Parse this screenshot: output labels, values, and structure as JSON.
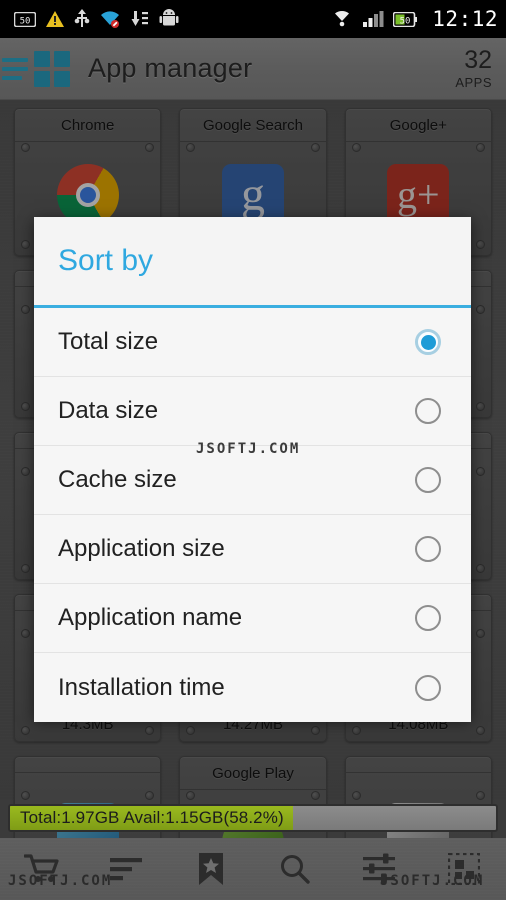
{
  "statusbar": {
    "left_icons": [
      "battery-50-icon",
      "warning-triangle-icon",
      "usb-debug-icon",
      "wifi-off-icon",
      "download-icon",
      "android-robot-icon"
    ],
    "right_icons": [
      "wifi-icon",
      "signal-bars-icon",
      "battery-icon"
    ],
    "time": "12:12"
  },
  "actionbar": {
    "menu_icon": "hamburger-icon",
    "app_icon": "grid-icon",
    "title": "App manager",
    "count": "32",
    "count_label": "APPS",
    "accent": "#1b687e"
  },
  "grid": {
    "tiles": [
      {
        "name": "Chrome",
        "size": "",
        "icon": "chrome"
      },
      {
        "name": "Google Search",
        "size": "",
        "icon": "gsearch"
      },
      {
        "name": "Google+",
        "size": "",
        "icon": "gplus"
      },
      {
        "name": "",
        "size": "",
        "icon": "gen4"
      },
      {
        "name": "",
        "size": "",
        "icon": "gen5"
      },
      {
        "name": "",
        "size": "",
        "icon": "gen6"
      },
      {
        "name": "",
        "size": "",
        "icon": "gen3"
      },
      {
        "name": "",
        "size": "",
        "icon": "gen1"
      },
      {
        "name": "",
        "size": "",
        "icon": "gen2"
      },
      {
        "name": "",
        "size": "14.3MB",
        "icon": "gen1"
      },
      {
        "name": "",
        "size": "14.27MB",
        "icon": "gen2"
      },
      {
        "name": "",
        "size": "14.08MB",
        "icon": "gen3"
      },
      {
        "name": "",
        "size": "",
        "icon": "gen4"
      },
      {
        "name": "Google Play",
        "size": "",
        "icon": "gen5"
      },
      {
        "name": "",
        "size": "",
        "icon": "gen6"
      }
    ]
  },
  "dialog": {
    "title": "Sort by",
    "title_color": "#2fa8e0",
    "rule_color": "#3aaee0",
    "options": [
      {
        "label": "Total size",
        "selected": true
      },
      {
        "label": "Data size",
        "selected": false
      },
      {
        "label": "Cache size",
        "selected": false
      },
      {
        "label": "Application size",
        "selected": false
      },
      {
        "label": "Application name",
        "selected": false
      },
      {
        "label": "Installation time",
        "selected": false
      }
    ],
    "selected_color": "#1e9cd7"
  },
  "storage": {
    "text": "Total:1.97GB   Avail:1.15GB(58.2%)",
    "percent": 58.2,
    "fill_color": "#8fae1b"
  },
  "bottomnav": {
    "items": [
      {
        "icon": "cart-icon",
        "label": ""
      },
      {
        "icon": "sort-icon",
        "label": ""
      },
      {
        "icon": "bookmark-star-icon",
        "label": ""
      },
      {
        "icon": "search-icon",
        "label": ""
      },
      {
        "icon": "sliders-icon",
        "label": ""
      },
      {
        "icon": "select-grid-icon",
        "label": ""
      }
    ]
  },
  "watermarks": {
    "center": "JSOFTJ.COM",
    "left": "JSOFTJ.COM",
    "right": "JSOFTJ.COM"
  }
}
